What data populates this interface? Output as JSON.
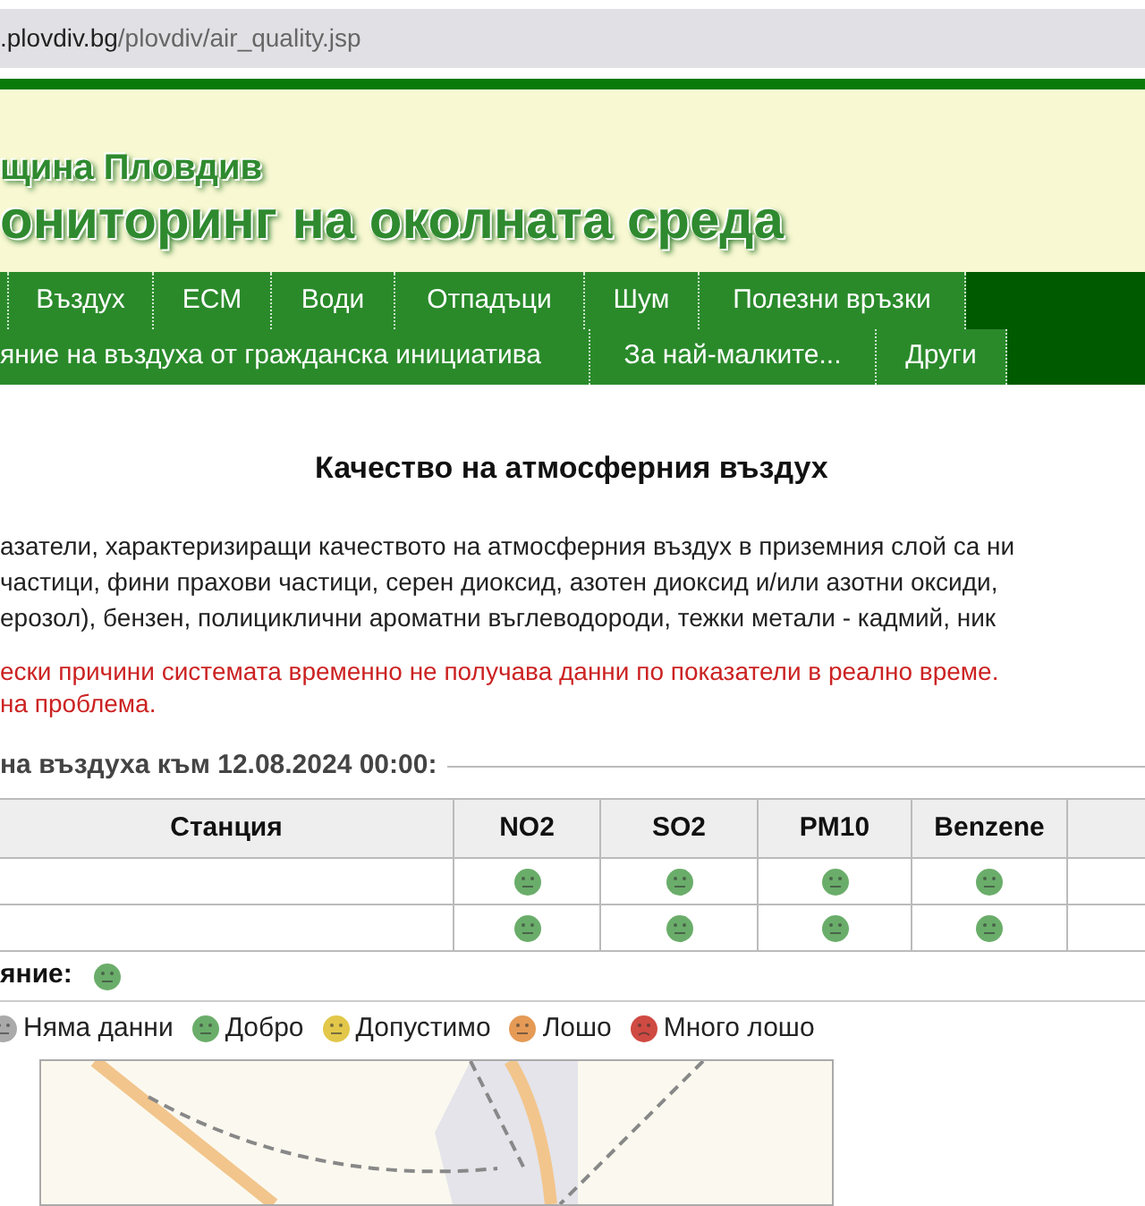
{
  "address_bar": {
    "domain": ".plovdiv.bg",
    "path": "/plovdiv/air_quality.jsp"
  },
  "header": {
    "subtitle": "щина Пловдив",
    "title": "ониторинг на околната среда"
  },
  "nav": {
    "row_1": [
      {
        "label": "Въздух"
      },
      {
        "label": "ЕСМ"
      },
      {
        "label": "Води"
      },
      {
        "label": "Отпадъци"
      },
      {
        "label": "Шум"
      },
      {
        "label": "Полезни връзки"
      }
    ],
    "row_2": [
      {
        "label": "яние на въздуха от гражданска инициатива"
      },
      {
        "label": "За най-малките..."
      },
      {
        "label": "Други"
      }
    ]
  },
  "page_title": "Качество на атмосферния въздух",
  "intro": [
    "азатели, характеризиращи качеството на атмосферния въздух в приземния слой са ни",
    "частици, фини прахови частици, серен диоксид, азотен диоксид и/или азотни оксиди,",
    "ерозол), бензен, полициклични ароматни въглеводороди, тежки метали - кадмий, ник"
  ],
  "notice": [
    "ески причини системата временно не получава данни по показатели в реално време.",
    "на проблема."
  ],
  "reading_heading": "на въздуха към 12.08.2024 00:00:",
  "table": {
    "columns": [
      "Станция",
      "NO2",
      "SO2",
      "PM10",
      "Benzene"
    ],
    "rows": [
      {
        "cells": [
          {
            "color": "#6aad6a",
            "kind": "neutral"
          },
          {
            "color": "#6aad6a",
            "kind": "neutral"
          },
          {
            "color": "#6aad6a",
            "kind": "neutral"
          },
          {
            "color": "#6aad6a",
            "kind": "neutral"
          }
        ]
      },
      {
        "cells": [
          {
            "color": "#6aad6a",
            "kind": "neutral"
          },
          {
            "color": "#6aad6a",
            "kind": "neutral"
          },
          {
            "color": "#6aad6a",
            "kind": "neutral"
          },
          {
            "color": "#6aad6a",
            "kind": "neutral"
          }
        ]
      }
    ]
  },
  "summary": {
    "label": "яние:",
    "color": "#6aad6a",
    "kind": "neutral"
  },
  "legend": [
    {
      "label": "Няма данни",
      "color": "#aaaaaa",
      "kind": "neutral"
    },
    {
      "label": "Добро",
      "color": "#6aad6a",
      "kind": "neutral"
    },
    {
      "label": "Допустимо",
      "color": "#e2c74a",
      "kind": "neutral"
    },
    {
      "label": "Лошо",
      "color": "#e59a55",
      "kind": "neutral"
    },
    {
      "label": "Много лошо",
      "color": "#cf4a42",
      "kind": "sad"
    }
  ]
}
